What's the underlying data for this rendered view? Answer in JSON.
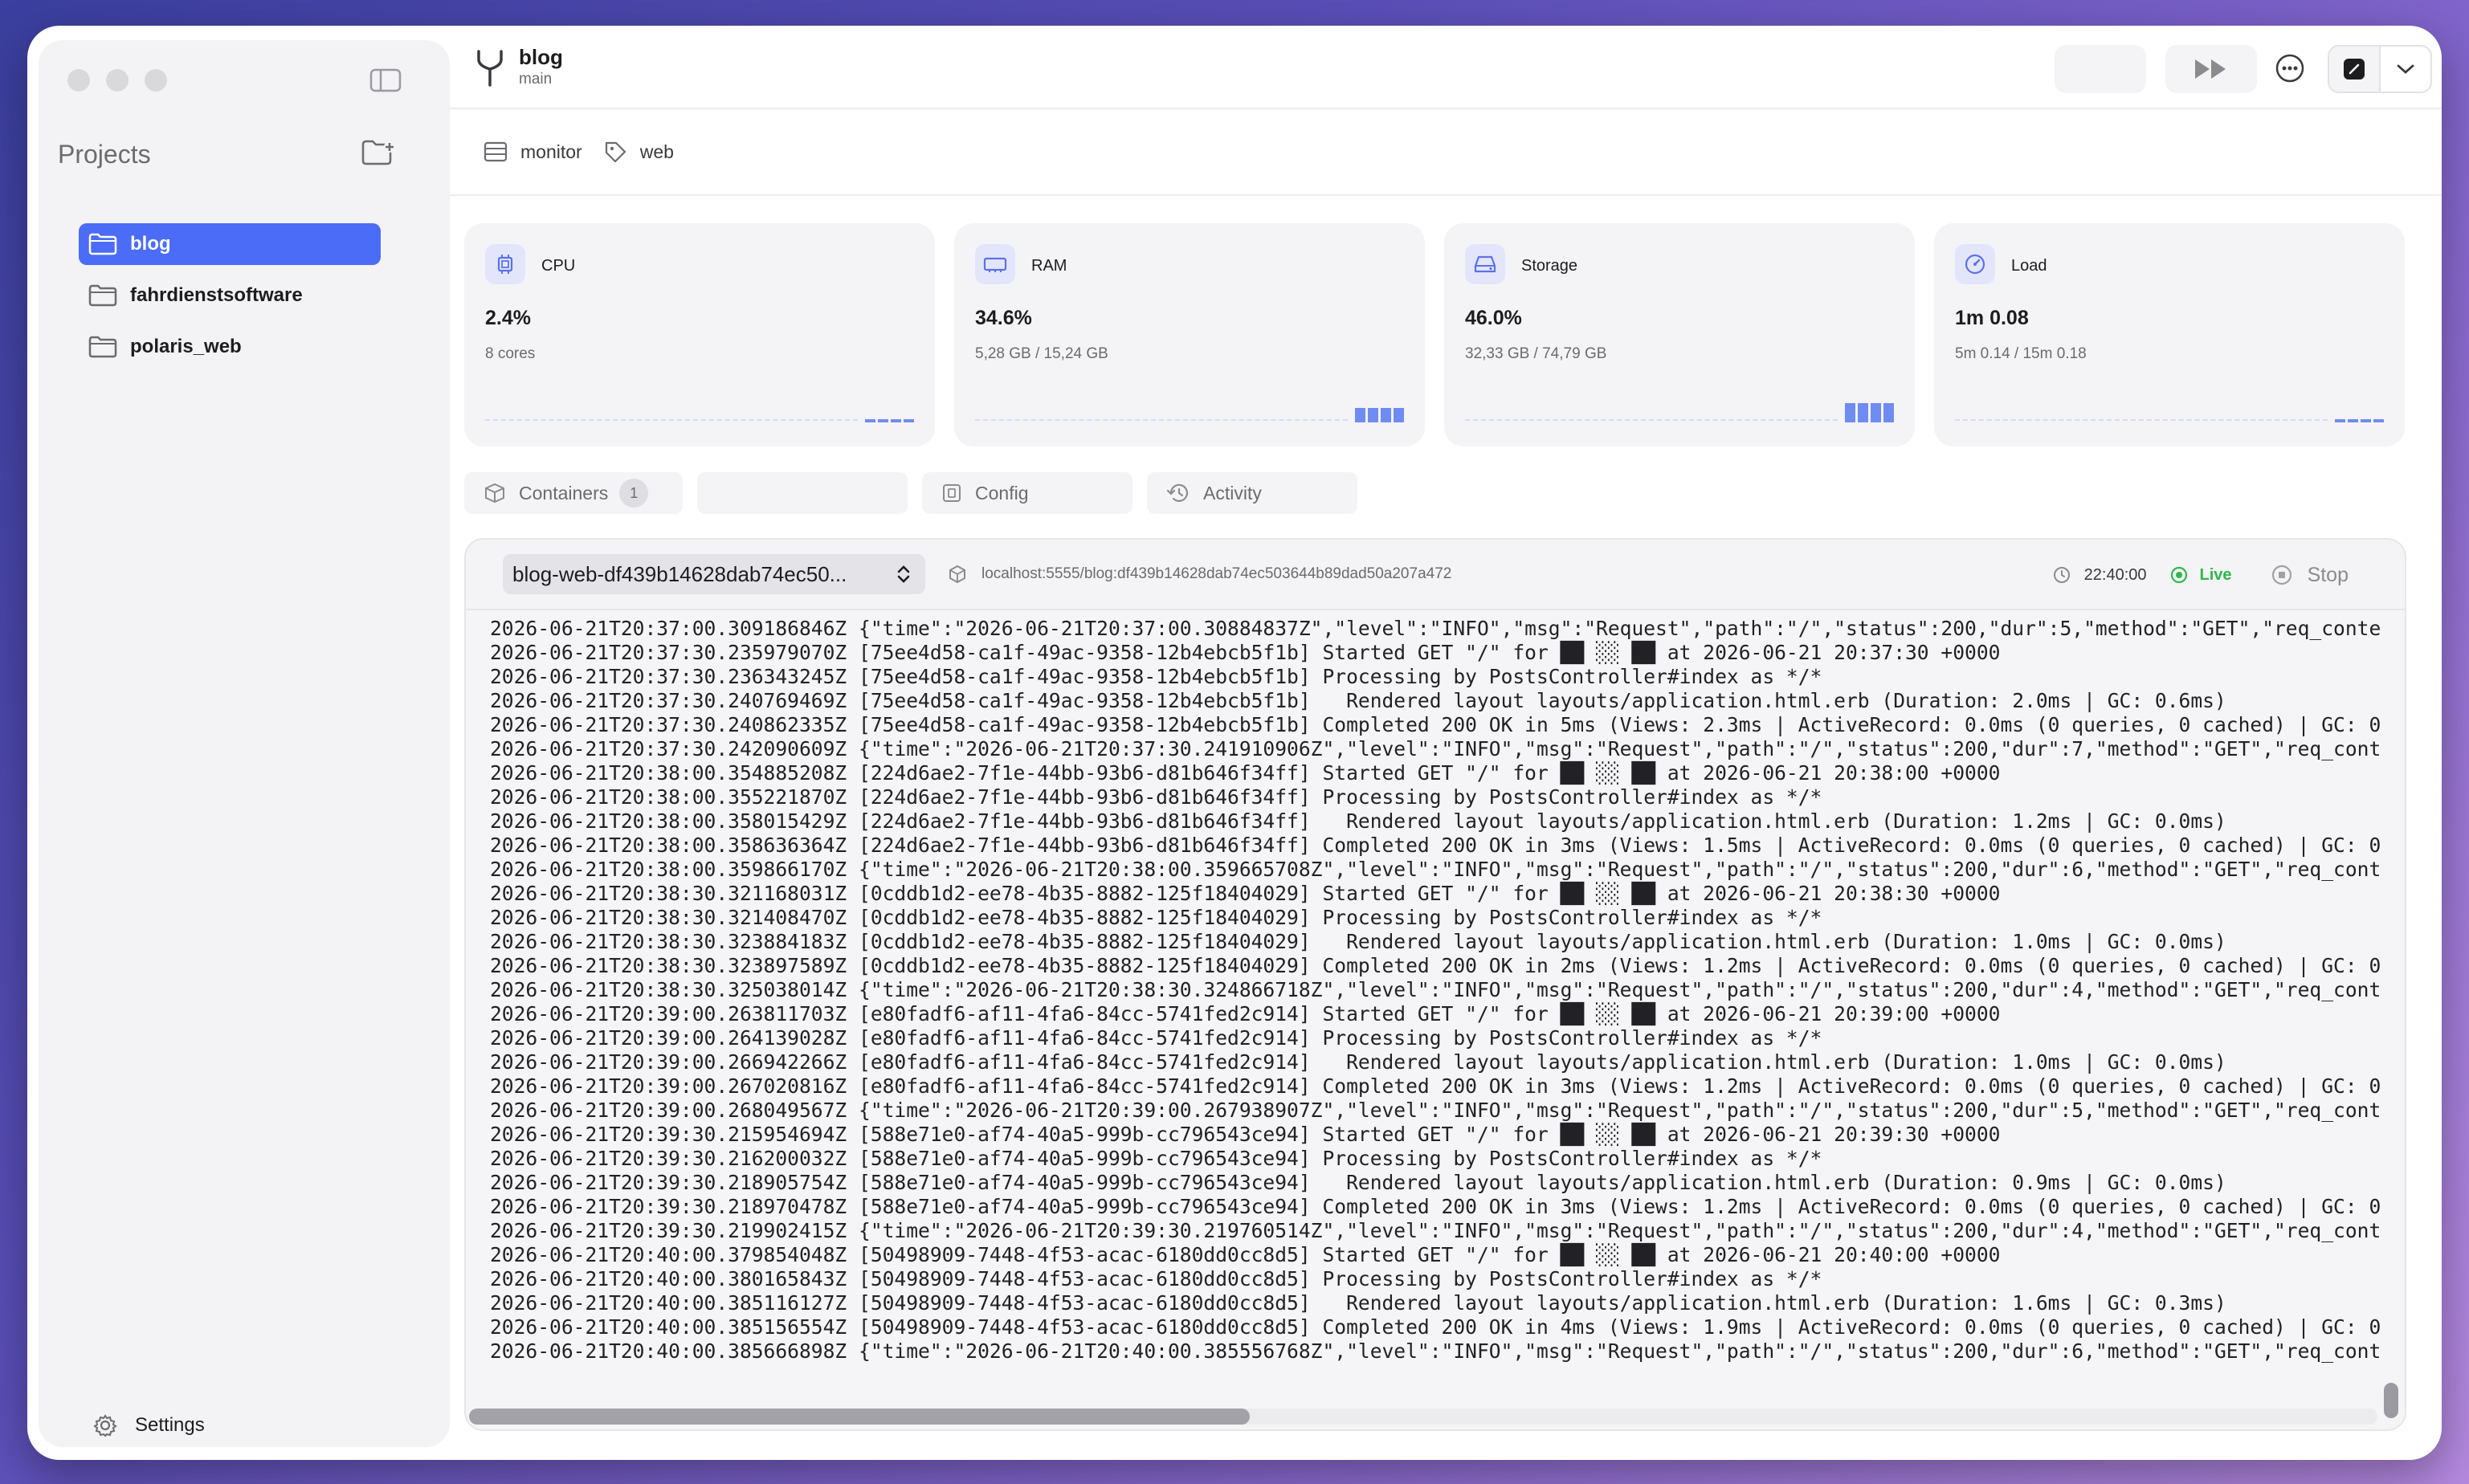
{
  "sidebar": {
    "projects_title": "Projects",
    "items": [
      {
        "label": "blog",
        "active": true
      },
      {
        "label": "fahrdienstsoftware",
        "active": false
      },
      {
        "label": "polaris_web",
        "active": false
      }
    ],
    "settings_label": "Settings"
  },
  "header": {
    "project": "blog",
    "branch": "main"
  },
  "subheader": {
    "tag1": "monitor",
    "tag2": "web"
  },
  "metrics": [
    {
      "label": "CPU",
      "value": "2.4%",
      "sub": "8 cores",
      "icon": "cpu-icon"
    },
    {
      "label": "RAM",
      "value": "34.6%",
      "sub": "5,28 GB / 15,24 GB",
      "icon": "memory-icon"
    },
    {
      "label": "Storage",
      "value": "46.0%",
      "sub": "32,33 GB / 74,79 GB",
      "icon": "drive-icon"
    },
    {
      "label": "Load",
      "value": "1m 0.08",
      "sub": "5m 0.14 / 15m 0.18",
      "icon": "gauge-icon"
    }
  ],
  "tabs": {
    "containers": "Containers",
    "containers_count": "1",
    "config": "Config",
    "activity": "Activity"
  },
  "logs": {
    "container": "blog-web-df439b14628dab74ec50...",
    "url": "localhost:5555/blog:df439b14628dab74ec503644b89dad50a207a472",
    "time": "22:40:00",
    "live": "Live",
    "stop": "Stop",
    "lines": [
      "2026-06-21T20:37:00.309186846Z {\"time\":\"2026-06-21T20:37:00.30884837Z\",\"level\":\"INFO\",\"msg\":\"Request\",\"path\":\"/\",\"status\":200,\"dur\":5,\"method\":\"GET\",\"req_conte",
      "2026-06-21T20:37:30.235979070Z [75ee4d58-ca1f-49ac-9358-12b4ebcb5f1b] Started GET \"/\" for ██ ░░ ██ at 2026-06-21 20:37:30 +0000",
      "2026-06-21T20:37:30.236343245Z [75ee4d58-ca1f-49ac-9358-12b4ebcb5f1b] Processing by PostsController#index as */*",
      "2026-06-21T20:37:30.240769469Z [75ee4d58-ca1f-49ac-9358-12b4ebcb5f1b]   Rendered layout layouts/application.html.erb (Duration: 2.0ms | GC: 0.6ms)",
      "2026-06-21T20:37:30.240862335Z [75ee4d58-ca1f-49ac-9358-12b4ebcb5f1b] Completed 200 OK in 5ms (Views: 2.3ms | ActiveRecord: 0.0ms (0 queries, 0 cached) | GC: 0",
      "2026-06-21T20:37:30.242090609Z {\"time\":\"2026-06-21T20:37:30.241910906Z\",\"level\":\"INFO\",\"msg\":\"Request\",\"path\":\"/\",\"status\":200,\"dur\":7,\"method\":\"GET\",\"req_cont",
      "2026-06-21T20:38:00.354885208Z [224d6ae2-7f1e-44bb-93b6-d81b646f34ff] Started GET \"/\" for ██ ░░ ██ at 2026-06-21 20:38:00 +0000",
      "2026-06-21T20:38:00.355221870Z [224d6ae2-7f1e-44bb-93b6-d81b646f34ff] Processing by PostsController#index as */*",
      "2026-06-21T20:38:00.358015429Z [224d6ae2-7f1e-44bb-93b6-d81b646f34ff]   Rendered layout layouts/application.html.erb (Duration: 1.2ms | GC: 0.0ms)",
      "2026-06-21T20:38:00.358636364Z [224d6ae2-7f1e-44bb-93b6-d81b646f34ff] Completed 200 OK in 3ms (Views: 1.5ms | ActiveRecord: 0.0ms (0 queries, 0 cached) | GC: 0",
      "2026-06-21T20:38:00.359866170Z {\"time\":\"2026-06-21T20:38:00.359665708Z\",\"level\":\"INFO\",\"msg\":\"Request\",\"path\":\"/\",\"status\":200,\"dur\":6,\"method\":\"GET\",\"req_cont",
      "2026-06-21T20:38:30.321168031Z [0cddb1d2-ee78-4b35-8882-125f18404029] Started GET \"/\" for ██ ░░ ██ at 2026-06-21 20:38:30 +0000",
      "2026-06-21T20:38:30.321408470Z [0cddb1d2-ee78-4b35-8882-125f18404029] Processing by PostsController#index as */*",
      "2026-06-21T20:38:30.323884183Z [0cddb1d2-ee78-4b35-8882-125f18404029]   Rendered layout layouts/application.html.erb (Duration: 1.0ms | GC: 0.0ms)",
      "2026-06-21T20:38:30.323897589Z [0cddb1d2-ee78-4b35-8882-125f18404029] Completed 200 OK in 2ms (Views: 1.2ms | ActiveRecord: 0.0ms (0 queries, 0 cached) | GC: 0",
      "2026-06-21T20:38:30.325038014Z {\"time\":\"2026-06-21T20:38:30.324866718Z\",\"level\":\"INFO\",\"msg\":\"Request\",\"path\":\"/\",\"status\":200,\"dur\":4,\"method\":\"GET\",\"req_cont",
      "2026-06-21T20:39:00.263811703Z [e80fadf6-af11-4fa6-84cc-5741fed2c914] Started GET \"/\" for ██ ░░ ██ at 2026-06-21 20:39:00 +0000",
      "2026-06-21T20:39:00.264139028Z [e80fadf6-af11-4fa6-84cc-5741fed2c914] Processing by PostsController#index as */*",
      "2026-06-21T20:39:00.266942266Z [e80fadf6-af11-4fa6-84cc-5741fed2c914]   Rendered layout layouts/application.html.erb (Duration: 1.0ms | GC: 0.0ms)",
      "2026-06-21T20:39:00.267020816Z [e80fadf6-af11-4fa6-84cc-5741fed2c914] Completed 200 OK in 3ms (Views: 1.2ms | ActiveRecord: 0.0ms (0 queries, 0 cached) | GC: 0",
      "2026-06-21T20:39:00.268049567Z {\"time\":\"2026-06-21T20:39:00.267938907Z\",\"level\":\"INFO\",\"msg\":\"Request\",\"path\":\"/\",\"status\":200,\"dur\":5,\"method\":\"GET\",\"req_cont",
      "2026-06-21T20:39:30.215954694Z [588e71e0-af74-40a5-999b-cc796543ce94] Started GET \"/\" for ██ ░░ ██ at 2026-06-21 20:39:30 +0000",
      "2026-06-21T20:39:30.216200032Z [588e71e0-af74-40a5-999b-cc796543ce94] Processing by PostsController#index as */*",
      "2026-06-21T20:39:30.218905754Z [588e71e0-af74-40a5-999b-cc796543ce94]   Rendered layout layouts/application.html.erb (Duration: 0.9ms | GC: 0.0ms)",
      "2026-06-21T20:39:30.218970478Z [588e71e0-af74-40a5-999b-cc796543ce94] Completed 200 OK in 3ms (Views: 1.2ms | ActiveRecord: 0.0ms (0 queries, 0 cached) | GC: 0",
      "2026-06-21T20:39:30.219902415Z {\"time\":\"2026-06-21T20:39:30.219760514Z\",\"level\":\"INFO\",\"msg\":\"Request\",\"path\":\"/\",\"status\":200,\"dur\":4,\"method\":\"GET\",\"req_cont",
      "2026-06-21T20:40:00.379854048Z [50498909-7448-4f53-acac-6180dd0cc8d5] Started GET \"/\" for ██ ░░ ██ at 2026-06-21 20:40:00 +0000",
      "2026-06-21T20:40:00.380165843Z [50498909-7448-4f53-acac-6180dd0cc8d5] Processing by PostsController#index as */*",
      "2026-06-21T20:40:00.385116127Z [50498909-7448-4f53-acac-6180dd0cc8d5]   Rendered layout layouts/application.html.erb (Duration: 1.6ms | GC: 0.3ms)",
      "2026-06-21T20:40:00.385156554Z [50498909-7448-4f53-acac-6180dd0cc8d5] Completed 200 OK in 4ms (Views: 1.9ms | ActiveRecord: 0.0ms (0 queries, 0 cached) | GC: 0",
      "2026-06-21T20:40:00.385666898Z {\"time\":\"2026-06-21T20:40:00.385556768Z\",\"level\":\"INFO\",\"msg\":\"Request\",\"path\":\"/\",\"status\":200,\"dur\":6,\"method\":\"GET\",\"req_cont"
    ]
  },
  "colors": {
    "accent": "#4a6cf7",
    "live": "#2fb84a"
  }
}
